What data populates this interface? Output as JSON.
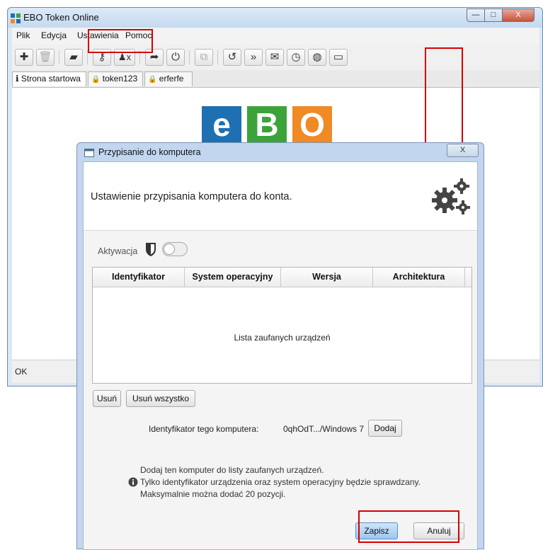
{
  "window": {
    "title": "EBO Token Online",
    "buttons": {
      "minimize": "—",
      "maximize": "□",
      "close": "X"
    }
  },
  "menu": [
    "Plik",
    "Edycja",
    "Ustawienia",
    "Pomoc"
  ],
  "toolbar": {
    "icons": [
      "plus-icon",
      "trash-icon",
      "notebook-icon",
      "key-icon",
      "remove-user-icon",
      "logout-icon",
      "power-icon",
      "copy-icon",
      "history-icon",
      "forward-icon",
      "envelope-icon",
      "clock-icon",
      "globe-icon",
      "monitor-icon"
    ],
    "glyphs": {
      "plus": "✚",
      "trash": "🗑",
      "notebook": "▰",
      "key": "⚷",
      "remove_user": "♟x",
      "logout": "➦",
      "power": "⏻",
      "copy": "⧉",
      "history": "↺",
      "forward": "»",
      "envelope": "✉",
      "clock": "◷",
      "globe": "◍",
      "monitor": "▭"
    }
  },
  "tabs": [
    {
      "icon": "info-icon",
      "glyph": "ℹ",
      "label": "Strona startowa"
    },
    {
      "icon": "lock-icon",
      "glyph": "🔒",
      "label": "token123"
    },
    {
      "icon": "lock-icon",
      "glyph": "🔒",
      "label": "erferfe"
    }
  ],
  "logo": {
    "letters": [
      "e",
      "B",
      "O"
    ],
    "colors": [
      "#1f6fb3",
      "#3ca33a",
      "#f08a24"
    ]
  },
  "status": {
    "text": "OK"
  },
  "dialog": {
    "title": "Przypisanie do komputera",
    "close": "X",
    "header_text": "Ustawienie przypisania komputera do konta.",
    "activation_label": "Aktywacja",
    "table": {
      "columns": [
        "Identyfikator",
        "System operacyjny",
        "Wersja",
        "Architektura"
      ],
      "placeholder": "Lista zaufanych urządzeń"
    },
    "buttons": {
      "remove": "Usuń",
      "remove_all": "Usuń wszystko",
      "add": "Dodaj",
      "save": "Zapisz",
      "cancel": "Anuluj"
    },
    "computer_id_label": "Identyfikator tego komputera:",
    "computer_id_value": "0qhOdT.../Windows 7",
    "info": [
      "Dodaj ten komputer do listy zaufanych urządzeń.",
      "Tylko identyfikator urządzenia oraz system operacyjny będzie sprawdzany.",
      "Maksymalnie można dodać 20 pozycji."
    ]
  },
  "colors": {
    "highlight_red": "#d40000",
    "save_blue": "#a9cdf0"
  }
}
